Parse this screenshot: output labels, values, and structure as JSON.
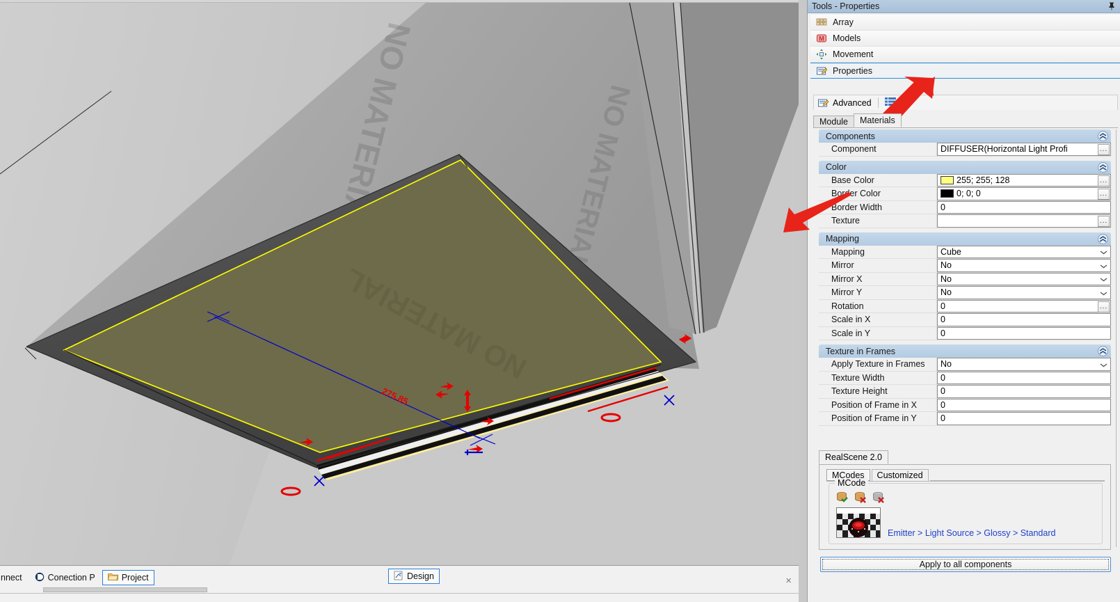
{
  "dock": {
    "title": "Tools - Properties",
    "pin_icon": "pin-icon",
    "nav_items": [
      {
        "label": "Array",
        "icon": "array-grid-icon",
        "selected": false
      },
      {
        "label": "Models",
        "icon": "models-m-icon",
        "selected": false
      },
      {
        "label": "Movement",
        "icon": "movement-arrows-icon",
        "selected": false
      },
      {
        "label": "Properties",
        "icon": "properties-page-icon",
        "selected": true
      }
    ],
    "advanced_label": "Advanced",
    "advanced_icon": "properties-page-icon",
    "list_view_icon": "list-view-icon",
    "tabs": [
      {
        "label": "Module",
        "selected": false
      },
      {
        "label": "Materials",
        "selected": true
      }
    ]
  },
  "property_groups": [
    {
      "title": "Components",
      "collapse_icon": "chevron-double-up-icon",
      "rows": [
        {
          "label": "Component",
          "value": "DIFFUSER(Horizontal Light Profi ",
          "control": "text-ellipsis",
          "editable": true
        }
      ]
    },
    {
      "title": "Color",
      "collapse_icon": "chevron-double-up-icon",
      "rows": [
        {
          "label": "Base Color",
          "value": "255; 255; 128",
          "control": "color-ellipsis",
          "swatch": "#ffff80",
          "editable": true
        },
        {
          "label": "Border Color",
          "value": "0; 0; 0",
          "control": "color-ellipsis",
          "swatch": "#000000",
          "editable": true
        },
        {
          "label": "Border Width",
          "value": "0",
          "control": "text",
          "editable": true
        },
        {
          "label": "Texture",
          "value": "",
          "control": "ellipsis",
          "editable": true
        }
      ]
    },
    {
      "title": "Mapping",
      "collapse_icon": "chevron-double-up-icon",
      "rows": [
        {
          "label": "Mapping",
          "value": "Cube",
          "control": "dropdown",
          "editable": true
        },
        {
          "label": "Mirror",
          "value": "No",
          "control": "dropdown",
          "editable": true
        },
        {
          "label": "Mirror X",
          "value": "No",
          "control": "dropdown",
          "editable": true
        },
        {
          "label": "Mirror Y",
          "value": "No",
          "control": "dropdown",
          "editable": true
        },
        {
          "label": "Rotation",
          "value": "0",
          "control": "ellipsis",
          "editable": true
        },
        {
          "label": "Scale in X",
          "value": "0",
          "control": "text",
          "editable": true
        },
        {
          "label": "Scale in Y",
          "value": "0",
          "control": "text",
          "editable": true
        }
      ]
    },
    {
      "title": "Texture in Frames",
      "collapse_icon": "chevron-double-up-icon",
      "rows": [
        {
          "label": "Apply Texture in Frames",
          "value": "No",
          "control": "dropdown",
          "editable": true
        },
        {
          "label": "Texture Width",
          "value": "0",
          "control": "text",
          "editable": true
        },
        {
          "label": "Texture Height",
          "value": "0",
          "control": "text",
          "editable": true
        },
        {
          "label": "Position of Frame  in X",
          "value": "0",
          "control": "text",
          "editable": true
        },
        {
          "label": "Position of Frame  in Y",
          "value": "0",
          "control": "text",
          "editable": true
        }
      ]
    }
  ],
  "realscene": {
    "tab_label": "RealScene 2.0",
    "sub_tabs": [
      {
        "label": "MCodes",
        "selected": true
      },
      {
        "label": "Customized",
        "selected": false
      }
    ],
    "group_label": "MCode",
    "toolbar_icons": [
      {
        "name": "add-mcode-icon"
      },
      {
        "name": "remove-mcode-icon"
      },
      {
        "name": "clear-mcode-icon"
      }
    ],
    "thumbnail_name": "material-preview-thumbnail",
    "material_path": "Emitter > Light Source > Glossy > Standard"
  },
  "apply_button": {
    "label": "Apply to all components"
  },
  "bottom_bar": {
    "tabs": [
      {
        "label": "nnect",
        "icon": null,
        "selected": false
      },
      {
        "label": "Conection P",
        "icon": "connection-icon",
        "selected": false
      },
      {
        "label": "Project",
        "icon": "folder-icon",
        "selected": true
      }
    ],
    "design_tab": {
      "label": "Design",
      "icon": "design-icon",
      "selected": true
    },
    "close_icon": "close-x-icon"
  },
  "viewport": {
    "watermark_text": "NO MATERIAL",
    "dimension_label": "275.85",
    "colors": {
      "background": "#c9c9c9",
      "panel_light": "#b8b8b8",
      "panel_mid": "#9b9b9b",
      "panel_dark": "#4a4a4a",
      "selected_face": "#6e6b4a",
      "selection_outline": "#ffff00",
      "diffuser_strip": "#ffeea0",
      "annotation_red": "#e50000",
      "annotation_blue": "#0000cc"
    }
  },
  "annotations": {
    "arrow_color": "#e8231a",
    "arrow_1_name": "red-callout-arrow-materials-tab",
    "arrow_2_name": "red-callout-arrow-base-color"
  }
}
